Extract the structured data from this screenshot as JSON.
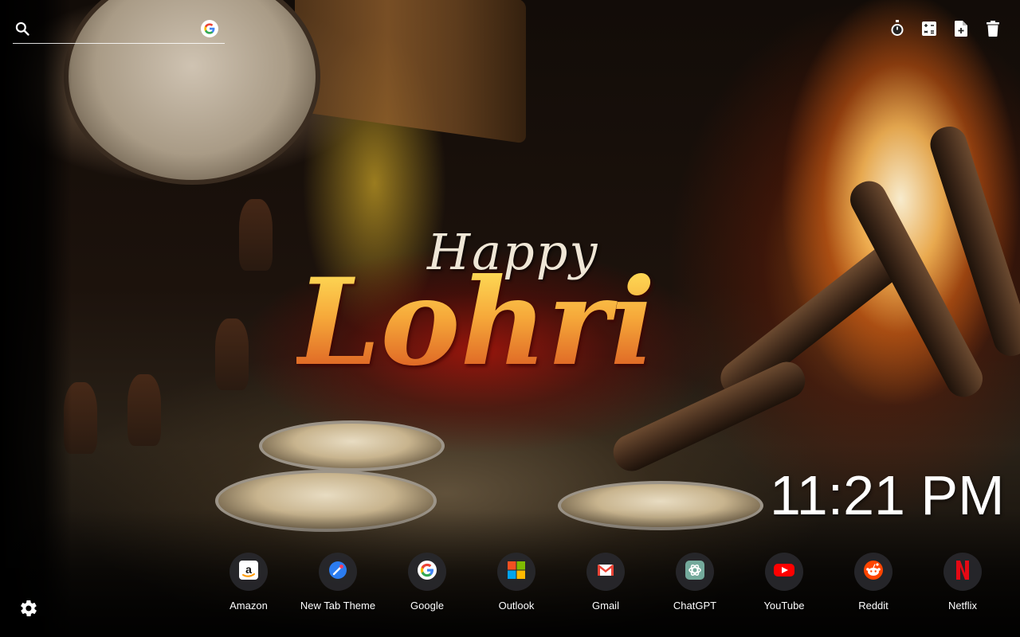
{
  "wallpaper": {
    "greeting_line1": "Happy",
    "greeting_line2": "Lohri"
  },
  "search": {
    "placeholder": "",
    "value": "",
    "engine_icon": "google-icon"
  },
  "toolbar": {
    "items": [
      {
        "name": "timer",
        "icon": "stopwatch-icon"
      },
      {
        "name": "calculator",
        "icon": "calculator-icon"
      },
      {
        "name": "new-note",
        "icon": "file-add-icon"
      },
      {
        "name": "delete",
        "icon": "trash-icon"
      }
    ]
  },
  "clock": {
    "time": "11:21 PM"
  },
  "shortcuts": [
    {
      "label": "Amazon",
      "icon": "amazon-icon"
    },
    {
      "label": "New Tab Theme",
      "icon": "new-tab-theme-icon"
    },
    {
      "label": "Google",
      "icon": "google-icon"
    },
    {
      "label": "Outlook",
      "icon": "microsoft-icon"
    },
    {
      "label": "Gmail",
      "icon": "gmail-icon"
    },
    {
      "label": "ChatGPT",
      "icon": "chatgpt-icon"
    },
    {
      "label": "YouTube",
      "icon": "youtube-icon"
    },
    {
      "label": "Reddit",
      "icon": "reddit-icon"
    },
    {
      "label": "Netflix",
      "icon": "netflix-icon"
    }
  ],
  "settings": {
    "icon": "gear-icon"
  },
  "colors": {
    "text": "#ffffff",
    "tile_background": "#28282c",
    "greeting_gold": "#f3a52a"
  }
}
